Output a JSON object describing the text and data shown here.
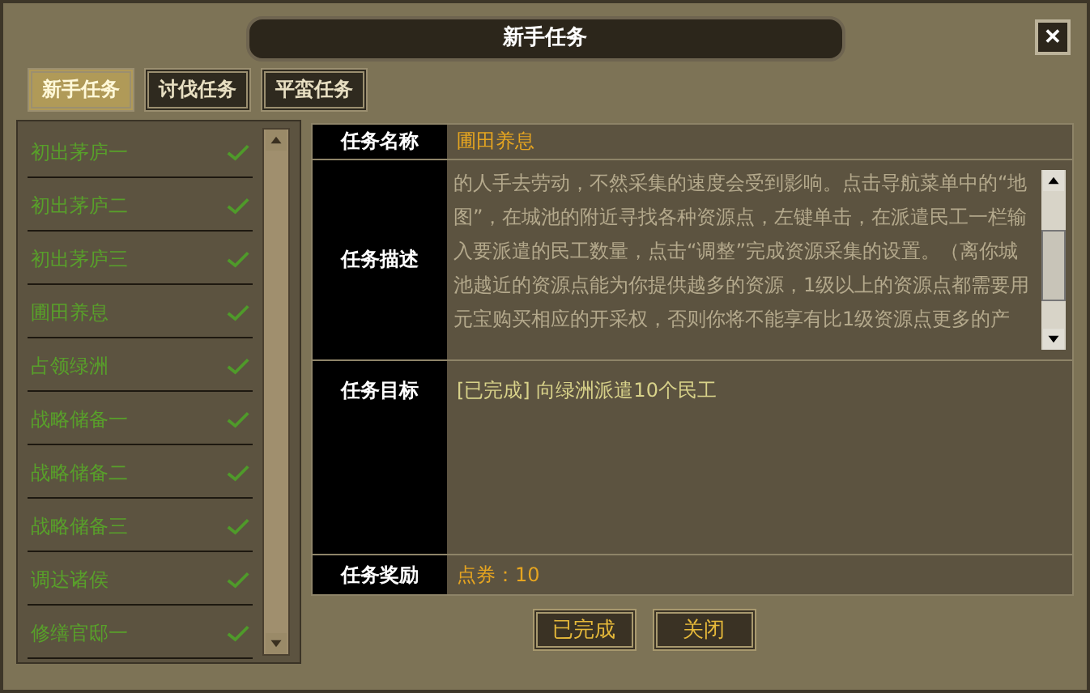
{
  "window": {
    "title": "新手任务",
    "close": "✕"
  },
  "tabs": [
    {
      "label": "新手任务",
      "selected": true
    },
    {
      "label": "讨伐任务",
      "selected": false
    },
    {
      "label": "平蛮任务",
      "selected": false
    }
  ],
  "quests": [
    {
      "name": "初出茅庐一",
      "completed": true
    },
    {
      "name": "初出茅庐二",
      "completed": true
    },
    {
      "name": "初出茅庐三",
      "completed": true
    },
    {
      "name": "圃田养息",
      "completed": true
    },
    {
      "name": "占领绿洲",
      "completed": true
    },
    {
      "name": "战略储备一",
      "completed": true
    },
    {
      "name": "战略储备二",
      "completed": true
    },
    {
      "name": "战略储备三",
      "completed": true
    },
    {
      "name": "调达诸侯",
      "completed": true
    },
    {
      "name": "修缮官邸一",
      "completed": true
    }
  ],
  "details": {
    "name_label": "任务名称",
    "name": "圃田养息",
    "description_label": "任务描述",
    "description_lines": [
      "的人手去劳动，不然采集的速度会受到影响。点击导航菜单中的“地",
      "图”，在城池的附近寻找各种资源点，左键单击，在派遣民工一栏输",
      "入要派遣的民工数量，点击“调整”完成资源采集的设置。（离你城",
      "池越近的资源点能为你提供越多的资源，1级以上的资源点都需要用",
      "元宝购买相应的开采权，否则你将不能享有比1级资源点更多的产"
    ],
    "goal_label": "任务目标",
    "goal": "[已完成] 向绿洲派遣10个民工",
    "reward_label": "任务奖励",
    "reward": "点券：10"
  },
  "buttons": [
    "已完成",
    "关闭"
  ]
}
